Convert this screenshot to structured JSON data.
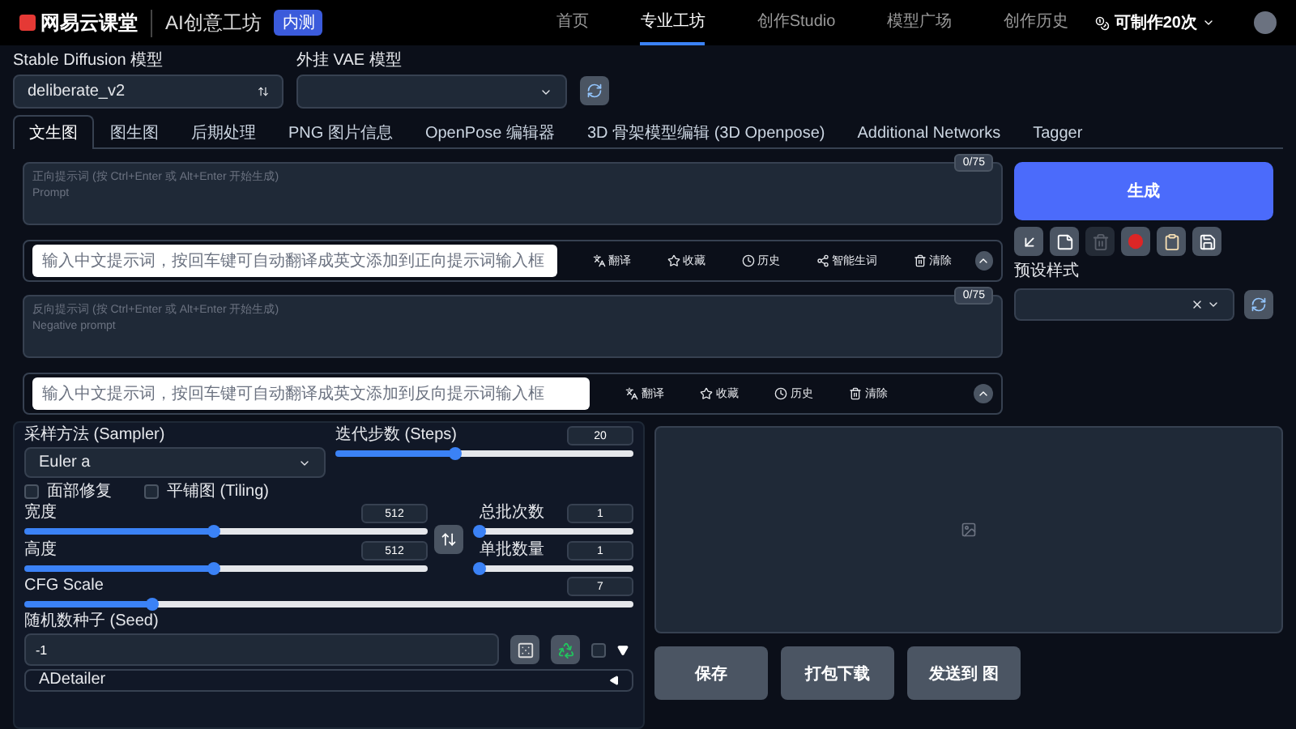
{
  "nav": {
    "brand": "网易云课堂",
    "product": "AI创意工坊",
    "badge": "内测",
    "links": [
      {
        "label": "首页",
        "selected": false
      },
      {
        "label": "专业工坊",
        "selected": true
      },
      {
        "label": "创作Studio",
        "selected": false
      },
      {
        "label": "模型广场",
        "selected": false
      },
      {
        "label": "创作历史",
        "selected": false
      }
    ],
    "credits": "可制作20次"
  },
  "models": [
    {
      "label": "Stable Diffusion 模型",
      "value": "deliberate_v2",
      "kind": "sort"
    },
    {
      "label": "外挂 VAE 模型",
      "kind": "dropdown"
    }
  ],
  "tabs": [
    {
      "label": "文生图",
      "selected": true
    },
    {
      "label": "图生图",
      "selected": false
    },
    {
      "label": "后期处理",
      "selected": false
    },
    {
      "label": "PNG 图片信息",
      "selected": false
    },
    {
      "label": "OpenPose 编辑器",
      "selected": false
    },
    {
      "label": "3D 骨架模型编辑 (3D Openpose)",
      "selected": false
    },
    {
      "label": "Additional Networks",
      "selected": false
    },
    {
      "label": "Tagger",
      "selected": false
    }
  ],
  "prompts": [
    {
      "placeholder": "正向提示词 (按 Ctrl+Enter 或 Alt+Enter 开始生成)\nPrompt",
      "count": "0/75",
      "helper": {
        "placeholder": "输入中文提示词，按回车键可自动翻译成英文添加到正向提示词输入框"
      },
      "actions": [
        {
          "kind": "translate",
          "label": "翻译"
        },
        {
          "kind": "favorite",
          "label": "收藏"
        },
        {
          "kind": "history",
          "label": "历史"
        },
        {
          "kind": "smart",
          "label": "智能生词"
        },
        {
          "kind": "clear",
          "label": "清除"
        }
      ]
    },
    {
      "placeholder": "反向提示词 (按 Ctrl+Enter 或 Alt+Enter 开始生成)\nNegative prompt",
      "count": "0/75",
      "helper": {
        "placeholder": "输入中文提示词，按回车键可自动翻译成英文添加到反向提示词输入框"
      },
      "actions": [
        {
          "kind": "translate",
          "label": "翻译"
        },
        {
          "kind": "favorite",
          "label": "收藏"
        },
        {
          "kind": "history",
          "label": "历史"
        },
        {
          "kind": "clear",
          "label": "清除"
        }
      ]
    }
  ],
  "generate": "生成",
  "tool_buttons": [
    {
      "kind": "apply",
      "disabled": false
    },
    {
      "kind": "note",
      "disabled": false
    },
    {
      "kind": "trash",
      "disabled": true
    },
    {
      "kind": "record",
      "disabled": false
    },
    {
      "kind": "paste",
      "disabled": false
    },
    {
      "kind": "save",
      "disabled": false
    }
  ],
  "preset": {
    "label": "预设样式"
  },
  "sampler": {
    "label": "采样方法 (Sampler)",
    "value": "Euler a"
  },
  "steps": {
    "label": "迭代步数 (Steps)",
    "value": "20",
    "level": 0.4
  },
  "checkboxes": [
    {
      "label": "面部修复",
      "checked": false
    },
    {
      "label": "平铺图 (Tiling)",
      "checked": false
    }
  ],
  "size": [
    {
      "label": "宽度",
      "value": "512",
      "level": 0.47
    },
    {
      "label": "高度",
      "value": "512",
      "level": 0.47
    }
  ],
  "batch": [
    {
      "label": "总批次数",
      "value": "1",
      "level": 0
    },
    {
      "label": "单批数量",
      "value": "1",
      "level": 0
    }
  ],
  "cfg": {
    "label": "CFG Scale",
    "value": "7",
    "level": 0.21
  },
  "seed": {
    "label": "随机数种子 (Seed)",
    "value": "-1",
    "extra_checked": false
  },
  "accordion": {
    "label": "ADetailer"
  },
  "output": {
    "actions": [
      "保存",
      "打包下载",
      "发送到 图"
    ]
  }
}
